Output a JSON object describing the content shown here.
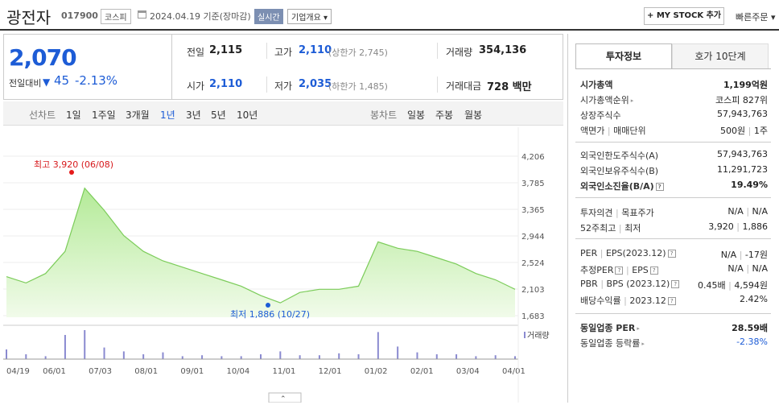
{
  "header": {
    "name": "광전자",
    "code": "017900",
    "market": "코스피",
    "date": "2024.04.19  기준(장마감)",
    "realtime": "실시간",
    "company_info": "기업개요 ▾",
    "mystock": "+ MY STOCK 추가",
    "quick_order": "빠른주문 ▾"
  },
  "price": {
    "current": "2,070",
    "diff_label": "전일대비",
    "diff_value": "45",
    "diff_rate": "-2.13%"
  },
  "stats": {
    "prev_label": "전일",
    "prev": "2,115",
    "high_label": "고가",
    "high": "2,110",
    "upper_limit": "(상한가 2,745)",
    "volume_label": "거래량",
    "volume": "354,136",
    "open_label": "시가",
    "open": "2,110",
    "low_label": "저가",
    "low": "2,035",
    "lower_limit": "(하한가 1,485)",
    "amount_label": "거래대금",
    "amount": "728 백만"
  },
  "periods": {
    "line_label": "선차트",
    "line": [
      "1일",
      "1주일",
      "3개월",
      "1년",
      "3년",
      "5년",
      "10년"
    ],
    "active": "1년",
    "candle_label": "봉차트",
    "candle": [
      "일봉",
      "주봉",
      "월봉"
    ]
  },
  "chart_data": {
    "type": "area",
    "x": [
      "04/19",
      "05/01",
      "05/15",
      "06/01",
      "06/08",
      "06/15",
      "07/01",
      "07/15",
      "08/01",
      "08/15",
      "09/01",
      "09/15",
      "10/01",
      "10/15",
      "10/27",
      "11/01",
      "11/15",
      "12/01",
      "12/15",
      "01/02",
      "01/15",
      "02/01",
      "02/15",
      "03/04",
      "03/15",
      "04/01",
      "04/19"
    ],
    "y": [
      2300,
      2200,
      2350,
      2700,
      3700,
      3350,
      2950,
      2700,
      2550,
      2450,
      2350,
      2250,
      2150,
      2000,
      1886,
      2050,
      2100,
      2100,
      2150,
      2850,
      2750,
      2700,
      2600,
      2500,
      2350,
      2250,
      2100
    ],
    "volume": [
      1,
      0.5,
      0.3,
      2.5,
      3,
      1.2,
      0.8,
      0.5,
      0.7,
      0.3,
      0.4,
      0.3,
      0.3,
      0.5,
      0.8,
      0.4,
      0.4,
      0.6,
      0.5,
      2.8,
      1.3,
      0.7,
      0.5,
      0.5,
      0.3,
      0.4,
      0.3
    ],
    "yticks": [
      "4,206",
      "3,785",
      "3,365",
      "2,944",
      "2,524",
      "2,103",
      "1,683"
    ],
    "xticks": [
      "04/19",
      "06/01",
      "07/03",
      "08/01",
      "09/01",
      "10/04",
      "11/01",
      "12/01",
      "01/02",
      "02/01",
      "03/04",
      "04/01"
    ],
    "ylim": [
      1683,
      4206
    ],
    "high_label": "최고 3,920 (06/08)",
    "low_label": "최저 1,886 (10/27)",
    "volume_label": "거래량",
    "color": "#8ddc6f"
  },
  "panel": {
    "tab_active": "투자정보",
    "tab_other": "호가 10단계",
    "rows1": [
      {
        "k": "시가총액",
        "v": "1,199억원"
      },
      {
        "k": "시가총액순위",
        "v": "코스피 827위"
      },
      {
        "k": "상장주식수",
        "v": "57,943,763"
      },
      {
        "k": "액면가",
        "k2": "매매단위",
        "v": "500원",
        "v2": "1주"
      }
    ],
    "rows2": [
      {
        "k": "외국인한도주식수(A)",
        "v": "57,943,763"
      },
      {
        "k": "외국인보유주식수(B)",
        "v": "11,291,723"
      },
      {
        "k": "외국인소진율(B/A)",
        "v": "19.49%"
      }
    ],
    "rows3": [
      {
        "k": "투자의견",
        "k2": "목표주가",
        "v": "N/A",
        "v2": "N/A"
      },
      {
        "k": "52주최고",
        "k2": "최저",
        "v": "3,920",
        "v2": "1,886"
      }
    ],
    "rows4": [
      {
        "k": "PER",
        "k2": "EPS(2023.12)",
        "v": "N/A",
        "v2": "-17원"
      },
      {
        "k": "추정PER",
        "k2": "EPS",
        "v": "N/A",
        "v2": "N/A"
      },
      {
        "k": "PBR",
        "k2": "BPS (2023.12)",
        "v": "0.45배",
        "v2": "4,594원"
      },
      {
        "k": "배당수익률",
        "k2": "2023.12",
        "v": "2.42%"
      }
    ],
    "rows5": [
      {
        "k": "동일업종 PER",
        "v": "28.59배"
      },
      {
        "k": "동일업종 등락률",
        "v": "-2.38%"
      }
    ]
  }
}
